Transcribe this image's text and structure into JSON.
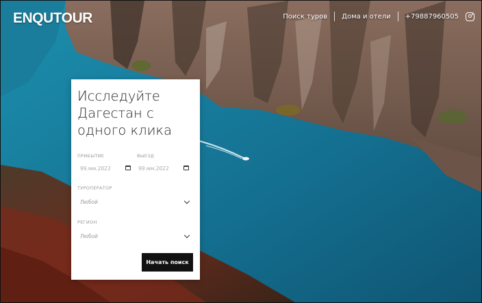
{
  "header": {
    "logo": "ENQUTOUR",
    "nav": [
      "Поиск туров",
      "Дома и отели",
      "+79887960505"
    ],
    "instagram_icon": "instagram-icon"
  },
  "search": {
    "title": "Исследуйте Дагестан с одного клика",
    "arrival_label": "ПРИБЫТИЕ",
    "arrival_placeholder": "99.мм.2022",
    "departure_label": "ВЫЕЗД",
    "departure_placeholder": "99.мм.2022",
    "operator_label": "ТУРОПЕРАТОР",
    "operator_value": "Любой",
    "region_label": "РЕГИОН",
    "region_value": "Любой",
    "submit_label": "Начать поиск"
  }
}
